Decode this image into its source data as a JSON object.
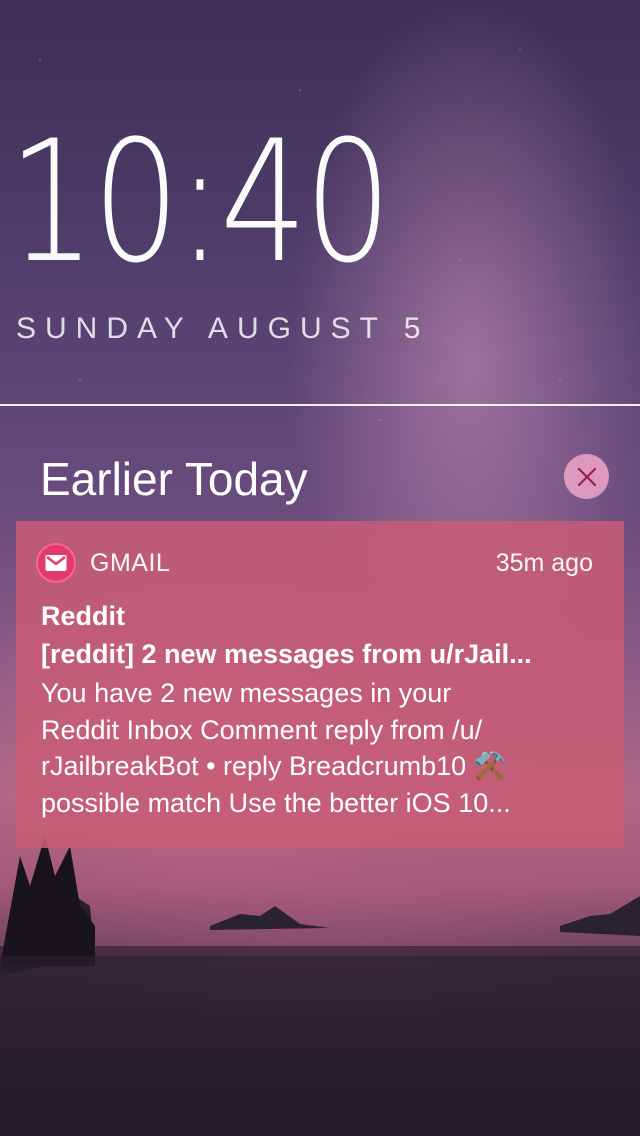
{
  "lock_screen": {
    "time": "10:40",
    "date": "SUNDAY AUGUST 5"
  },
  "notifications_header": {
    "title": "Earlier Today",
    "clear_icon": "close-icon"
  },
  "notification": {
    "app_icon": "gmail-icon",
    "app_name": "GMAIL",
    "time_ago": "35m ago",
    "sender": "Reddit",
    "subject": "[reddit] 2 new messages from u/rJail...",
    "body_line_1": "You have 2 new messages in your",
    "body_line_2": "Reddit Inbox Comment reply from /u/",
    "body_line_3": "rJailbreakBot • reply Breadcrumb10 ⚒️",
    "body_line_4": "possible match Use the better iOS 10..."
  },
  "colors": {
    "notification_bg": "#c65c76",
    "clear_button_bg": "#e8a0c4",
    "clear_icon_color": "#9a1f4a",
    "gmail_icon_bg": "#e23a6a"
  }
}
